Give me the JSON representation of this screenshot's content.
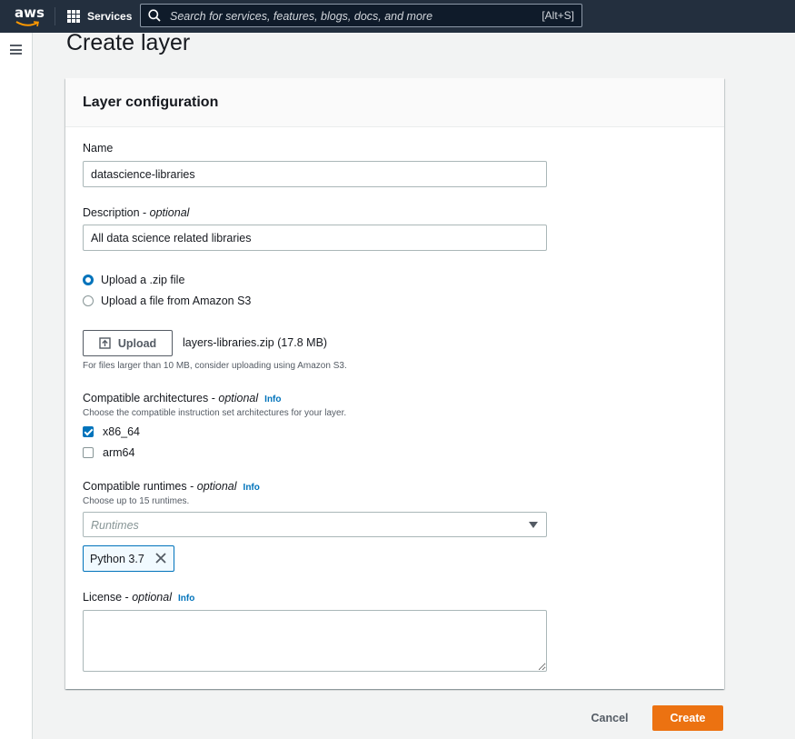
{
  "topnav": {
    "logo_text": "aws",
    "services_label": "Services",
    "search_placeholder": "Search for services, features, blogs, docs, and more",
    "search_shortcut": "[Alt+S]"
  },
  "page": {
    "title": "Create layer"
  },
  "layer_config": {
    "title": "Layer configuration",
    "name": {
      "label": "Name",
      "value": "datascience-libraries"
    },
    "description": {
      "label": "Description - ",
      "optional": "optional",
      "value": "All data science related libraries"
    },
    "upload_options": [
      {
        "label": "Upload a .zip file",
        "selected": true
      },
      {
        "label": "Upload a file from Amazon S3",
        "selected": false
      }
    ],
    "upload": {
      "button_label": "Upload",
      "file": "layers-libraries.zip (17.8 MB)",
      "hint": "For files larger than 10 MB, consider uploading using Amazon S3."
    },
    "architectures": {
      "label": "Compatible architectures - ",
      "optional": "optional",
      "info": "Info",
      "hint": "Choose the compatible instruction set architectures for your layer.",
      "options": [
        {
          "label": "x86_64",
          "checked": true
        },
        {
          "label": "arm64",
          "checked": false
        }
      ]
    },
    "runtimes": {
      "label": "Compatible runtimes - ",
      "optional": "optional",
      "info": "Info",
      "hint": "Choose up to 15 runtimes.",
      "placeholder": "Runtimes",
      "selected": [
        "Python 3.7"
      ]
    },
    "license": {
      "label": "License - ",
      "optional": "optional",
      "info": "Info",
      "value": ""
    }
  },
  "actions": {
    "cancel": "Cancel",
    "create": "Create"
  },
  "colors": {
    "nav_bg": "#232f3e",
    "accent_blue": "#0073bb",
    "primary_orange": "#ec7211"
  },
  "icons": {
    "logo": "aws-logo",
    "services": "grid-icon",
    "search": "search-icon",
    "menu": "hamburger-icon",
    "upload": "upload-icon",
    "select": "caret-down-icon",
    "remove_token": "close-icon"
  }
}
